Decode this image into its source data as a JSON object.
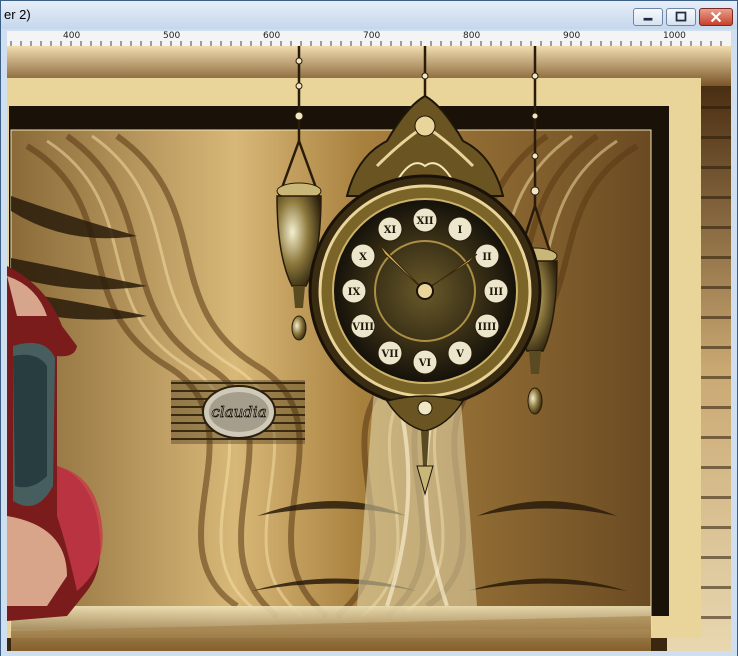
{
  "window": {
    "title": "er 2)",
    "buttons": {
      "minimize": "minimize-icon",
      "maximize": "maximize-icon",
      "close": "close-icon"
    }
  },
  "ruler": {
    "labels": [
      "400",
      "500",
      "600",
      "700",
      "800",
      "900",
      "1000"
    ]
  },
  "image": {
    "watermark_text": "claudia",
    "clock_numerals": [
      "XII",
      "I",
      "II",
      "III",
      "IIII",
      "V",
      "VI",
      "VII",
      "VIII",
      "IX",
      "X",
      "XI"
    ]
  },
  "colors": {
    "titlebar": "#c5d7ec",
    "close_button": "#c6412b",
    "gold_light": "#e9d49a",
    "gold_mid": "#b8924e",
    "gold_dark": "#5a3c18",
    "brown_dark": "#2b1a0c"
  }
}
